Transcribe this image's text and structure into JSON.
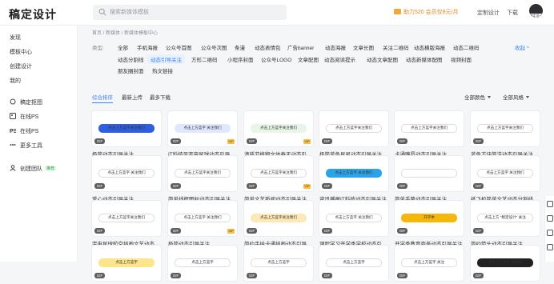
{
  "app": {
    "logo": "稿定设计"
  },
  "topbar": {
    "search_placeholder": "搜索新媒体模板",
    "vip_text": "助力520 会员仅8元/月",
    "links": [
      "定制设计",
      "下载"
    ],
    "avatar_tag": "稿定设计"
  },
  "sidebar": {
    "items": [
      {
        "label": "发现",
        "icon": "none"
      },
      {
        "label": "模板中心",
        "icon": "none"
      },
      {
        "label": "创建设计",
        "icon": "none"
      },
      {
        "label": "我的",
        "icon": "none"
      },
      {
        "label": "稿定抠图",
        "icon": "cutout-icon"
      },
      {
        "label": "在线PS",
        "icon": "image-icon"
      },
      {
        "label": "在线PS",
        "icon": "ps-icon"
      },
      {
        "label": "更多工具",
        "icon": "grid-icon"
      },
      {
        "label": "创建团队",
        "icon": "team-icon"
      }
    ],
    "team_badge": "推荐"
  },
  "breadcrumb": "首页 / 新媒体 / 新媒体模板中心",
  "filters": {
    "type_label": "类型:",
    "collapse_label": "收起 ^",
    "row1": [
      "全部",
      "手机海报",
      "公众号首图",
      "公众号次图",
      "条漫",
      "动态表情包",
      "广告banner",
      "动态海报",
      "文章长图",
      "关注二维码",
      "动态横版海报",
      "动态二维码"
    ],
    "row2": [
      "动态分割线",
      "动态引导关注",
      "方形二维码",
      "小程序封面",
      "公众号LOGO",
      "文章配图",
      "动态阅读提示",
      "动态文章配图",
      "动态新媒体配图",
      "视频封面"
    ],
    "row3": [
      "朋友圈封面",
      "热文链接"
    ],
    "active": "动态引导关注"
  },
  "sort": {
    "tabs": [
      "综合排序",
      "最新上传",
      "最多下载"
    ],
    "active": "综合排序",
    "color_label": "全部颜色",
    "style_label": "全部风格"
  },
  "cards": [
    {
      "caption": "极简动态引导关注",
      "thumb_text": "点击上方蓝字关注我们",
      "bar": "#2f5fe0",
      "vip": false
    },
    {
      "caption": "IT科技风宇宙星球动态引导...",
      "thumb_text": "点击上方蓝字 关注我们",
      "bar": "#dfe8ff",
      "vip": true
    },
    {
      "caption": "清新节植物文体春天动态引...",
      "thumb_text": "点击上方蓝字关注我们",
      "bar": "#e8f5e8",
      "vip": true
    },
    {
      "caption": "极简蓝色星星动态引导关注",
      "thumb_text": "点击上方蓝字关注我们",
      "bar": "#ffffff",
      "vip": false
    },
    {
      "caption": "卡通嘴唇动态引导关注",
      "thumb_text": "点击上方蓝字关注我们",
      "bar": "#ffffff",
      "vip": false
    },
    {
      "caption": "蓝色方块简洁动态引导关注",
      "thumb_text": "点击上方蓝字关注我们",
      "bar": "#ffffff",
      "vip": false
    },
    {
      "caption": "爱心动态引导关注",
      "thumb_text": "点击上方蓝字 关注我们",
      "bar": "#ffffff",
      "vip": false
    },
    {
      "caption": "简单线框图标动态引导关注",
      "thumb_text": "点击上方蓝字关注我们",
      "bar": "#ffffff",
      "vip": false
    },
    {
      "caption": "简单文艺新闻动态引导关注",
      "thumb_text": "点击上方蓝字关注我们",
      "bar": "#ffffff",
      "vip": true
    },
    {
      "caption": "资讯播报IT科技动态引导关注",
      "thumb_text": "点击上方蓝字 关注我们",
      "bar": "#2aa3e8",
      "vip": false
    },
    {
      "caption": "简单手势动态引导关注",
      "thumb_text": "",
      "bar": "#ffffff",
      "vip": false
    },
    {
      "caption": "纸飞机简单文艺动态分割线",
      "thumb_text": "点击上方蓝字 关注我们",
      "bar": "#ffffff",
      "vip": false
    },
    {
      "caption": "宇宙星球航空插画文艺动态...",
      "thumb_text": "点击上方蓝字关注我们",
      "bar": "#ffffff",
      "vip": false
    },
    {
      "caption": "极简动态引导关注",
      "thumb_text": "点击上方蓝字 关注我们",
      "bar": "#ffffff",
      "vip": true
    },
    {
      "caption": "简约手绘卡通插画动态引导...",
      "thumb_text": "点击上方蓝字关注我们",
      "bar": "#fde9b8",
      "vip": false
    },
    {
      "caption": "课程学习开学季学校动态引...",
      "thumb_text": "点击上方蓝字 关注我们",
      "bar": "#ffffff",
      "vip": false
    },
    {
      "caption": "开学季教育商务动态引导关注",
      "thumb_text": "开学季",
      "bar": "#f5b80a",
      "vip": false
    },
    {
      "caption": "简约箭头动态引导关注",
      "thumb_text": "点击上方 \"稿定设计\" 关注",
      "bar": "#ffffff",
      "vip": false
    },
    {
      "caption": "",
      "thumb_text": "点击上方蓝字",
      "bar": "#fde68a",
      "vip": false
    },
    {
      "caption": "",
      "thumb_text": "点击上方蓝字",
      "bar": "#ffffff",
      "vip": false
    },
    {
      "caption": "",
      "thumb_text": "点击上方蓝字",
      "bar": "#ffffff",
      "vip": false
    },
    {
      "caption": "",
      "thumb_text": "点击上方蓝字",
      "bar": "#ffffff",
      "vip": false
    },
    {
      "caption": "",
      "thumb_text": "点击上方蓝字 关注",
      "bar": "#ffffff",
      "vip": false
    },
    {
      "caption": "",
      "thumb_text": "点击上方关注 新媒体",
      "bar": "#222222",
      "vip": false
    }
  ],
  "colors": {
    "accent": "#3b82f6",
    "vip": "#f7c04a"
  }
}
